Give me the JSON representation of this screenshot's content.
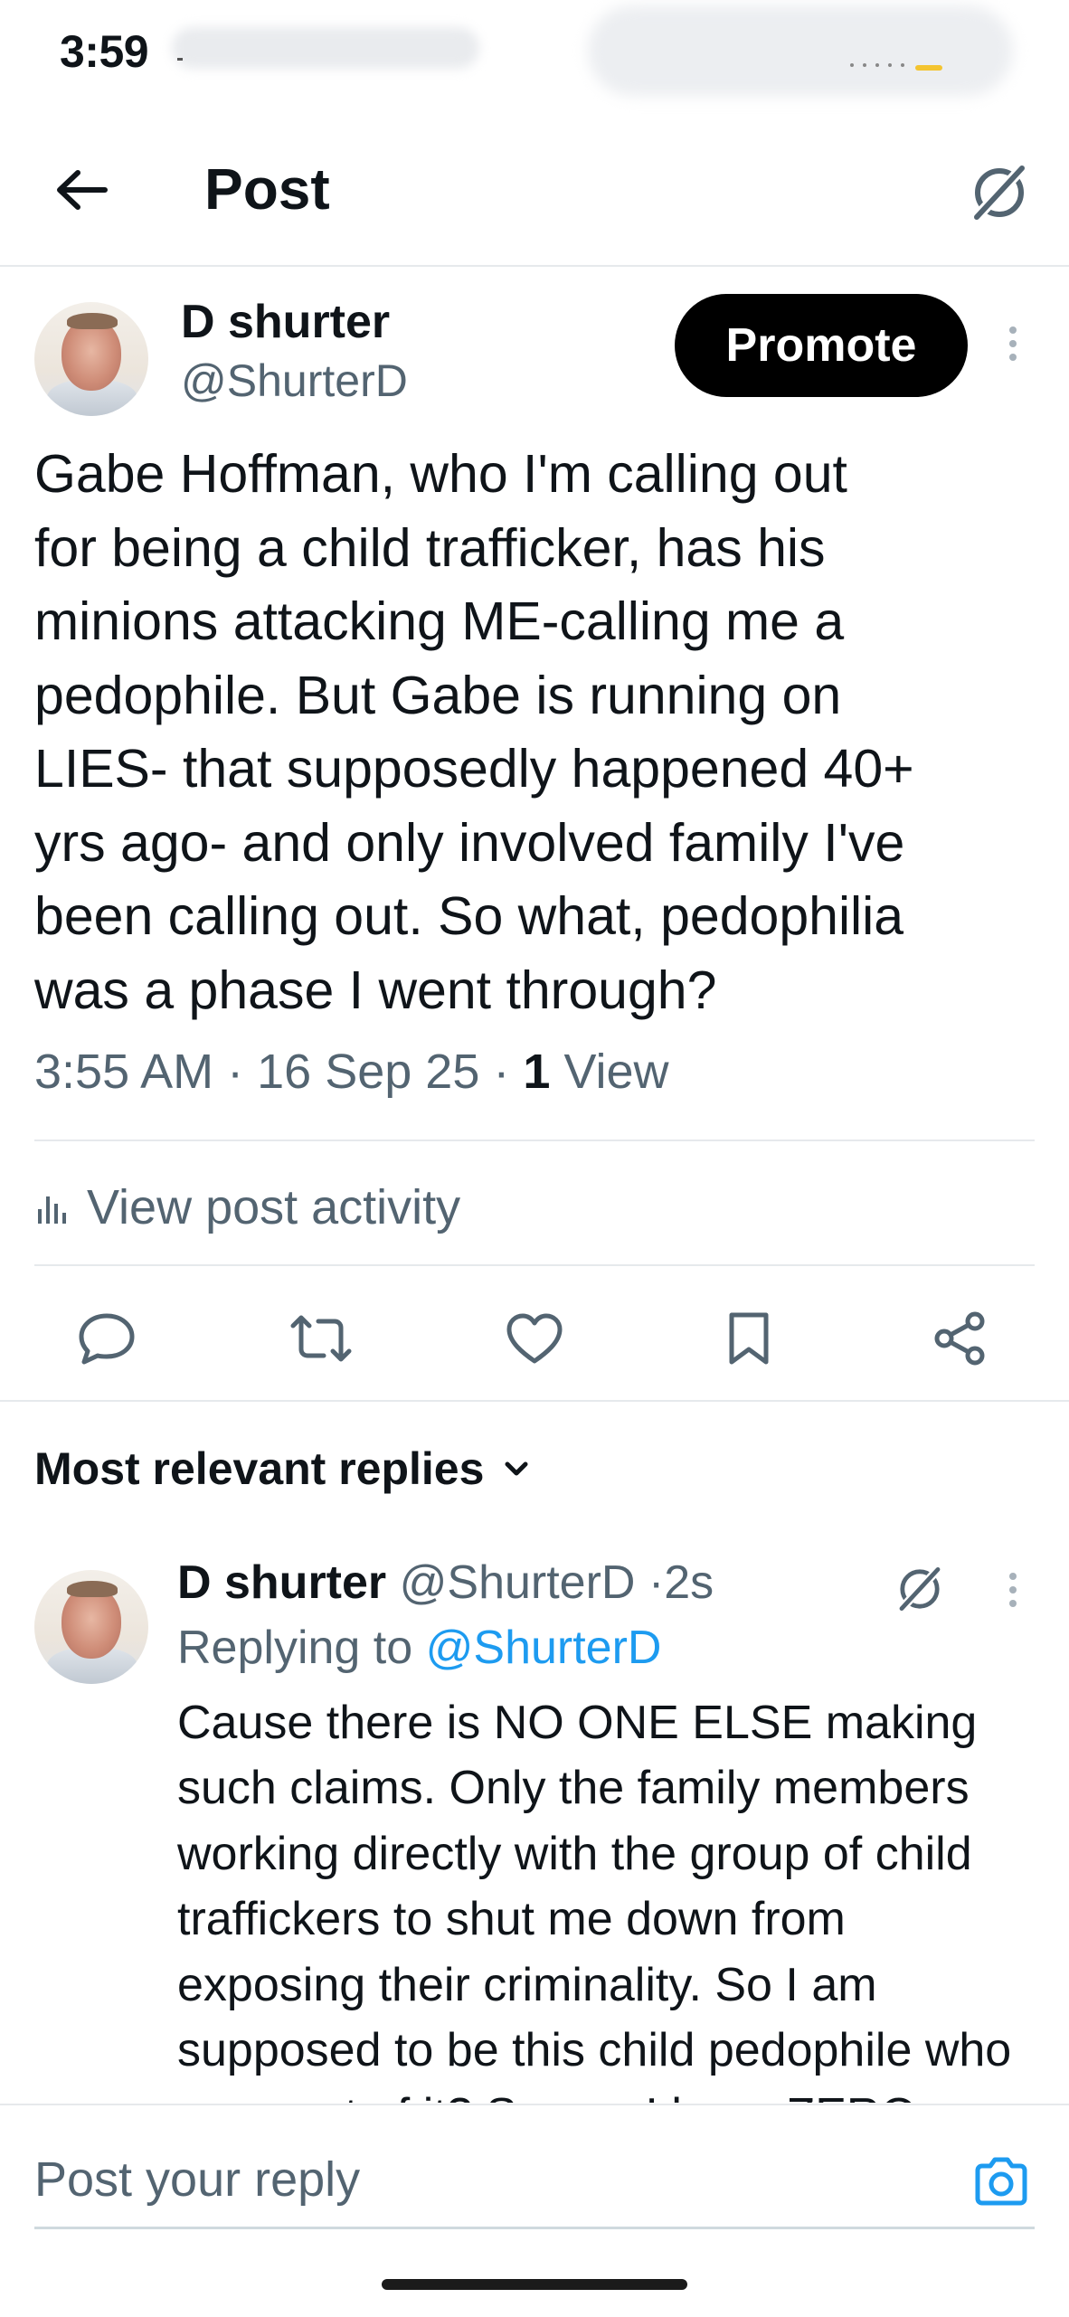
{
  "status_bar": {
    "time": "3:59"
  },
  "header": {
    "title": "Post",
    "back_icon": "arrow-left-icon",
    "grok_icon": "grok-icon"
  },
  "post": {
    "author_name": "D shurter",
    "author_handle": "@ShurterD",
    "promote_label": "Promote",
    "text": "Gabe Hoffman, who I'm calling out\nfor being a child trafficker, has his\nminions attacking ME-calling me a\npedophile. But Gabe is running on\nLIES- that supposedly happened 40+\nyrs ago- and only involved family I've\nbeen calling out. So what, pedophilia\nwas a phase I went through?",
    "time": "3:55 AM",
    "date": "16 Sep 25",
    "views_count": "1",
    "views_label": "View",
    "activity_label": "View post activity"
  },
  "actions": [
    {
      "name": "reply-icon"
    },
    {
      "name": "repost-icon"
    },
    {
      "name": "like-icon"
    },
    {
      "name": "bookmark-icon"
    },
    {
      "name": "share-icon"
    }
  ],
  "replies_sort": {
    "label": "Most relevant replies"
  },
  "reply": {
    "author_name": "D shurter",
    "author_handle": "@ShurterD",
    "time": "2s",
    "replying_prefix": "Replying to",
    "replying_to": "@ShurterD",
    "text": "Cause there is NO ONE ELSE making such claims. Only the family members working directly with the group of child traffickers to shut me down from exposing their criminality. So I am supposed to be this child pedophile who grew out of it? Seems I have ZERO"
  },
  "compose": {
    "placeholder": "Post your reply"
  },
  "colors": {
    "accent": "#1d9bf0",
    "secondary_text": "#536471",
    "primary_text": "#0f1419",
    "divider": "#e6e9ec"
  }
}
